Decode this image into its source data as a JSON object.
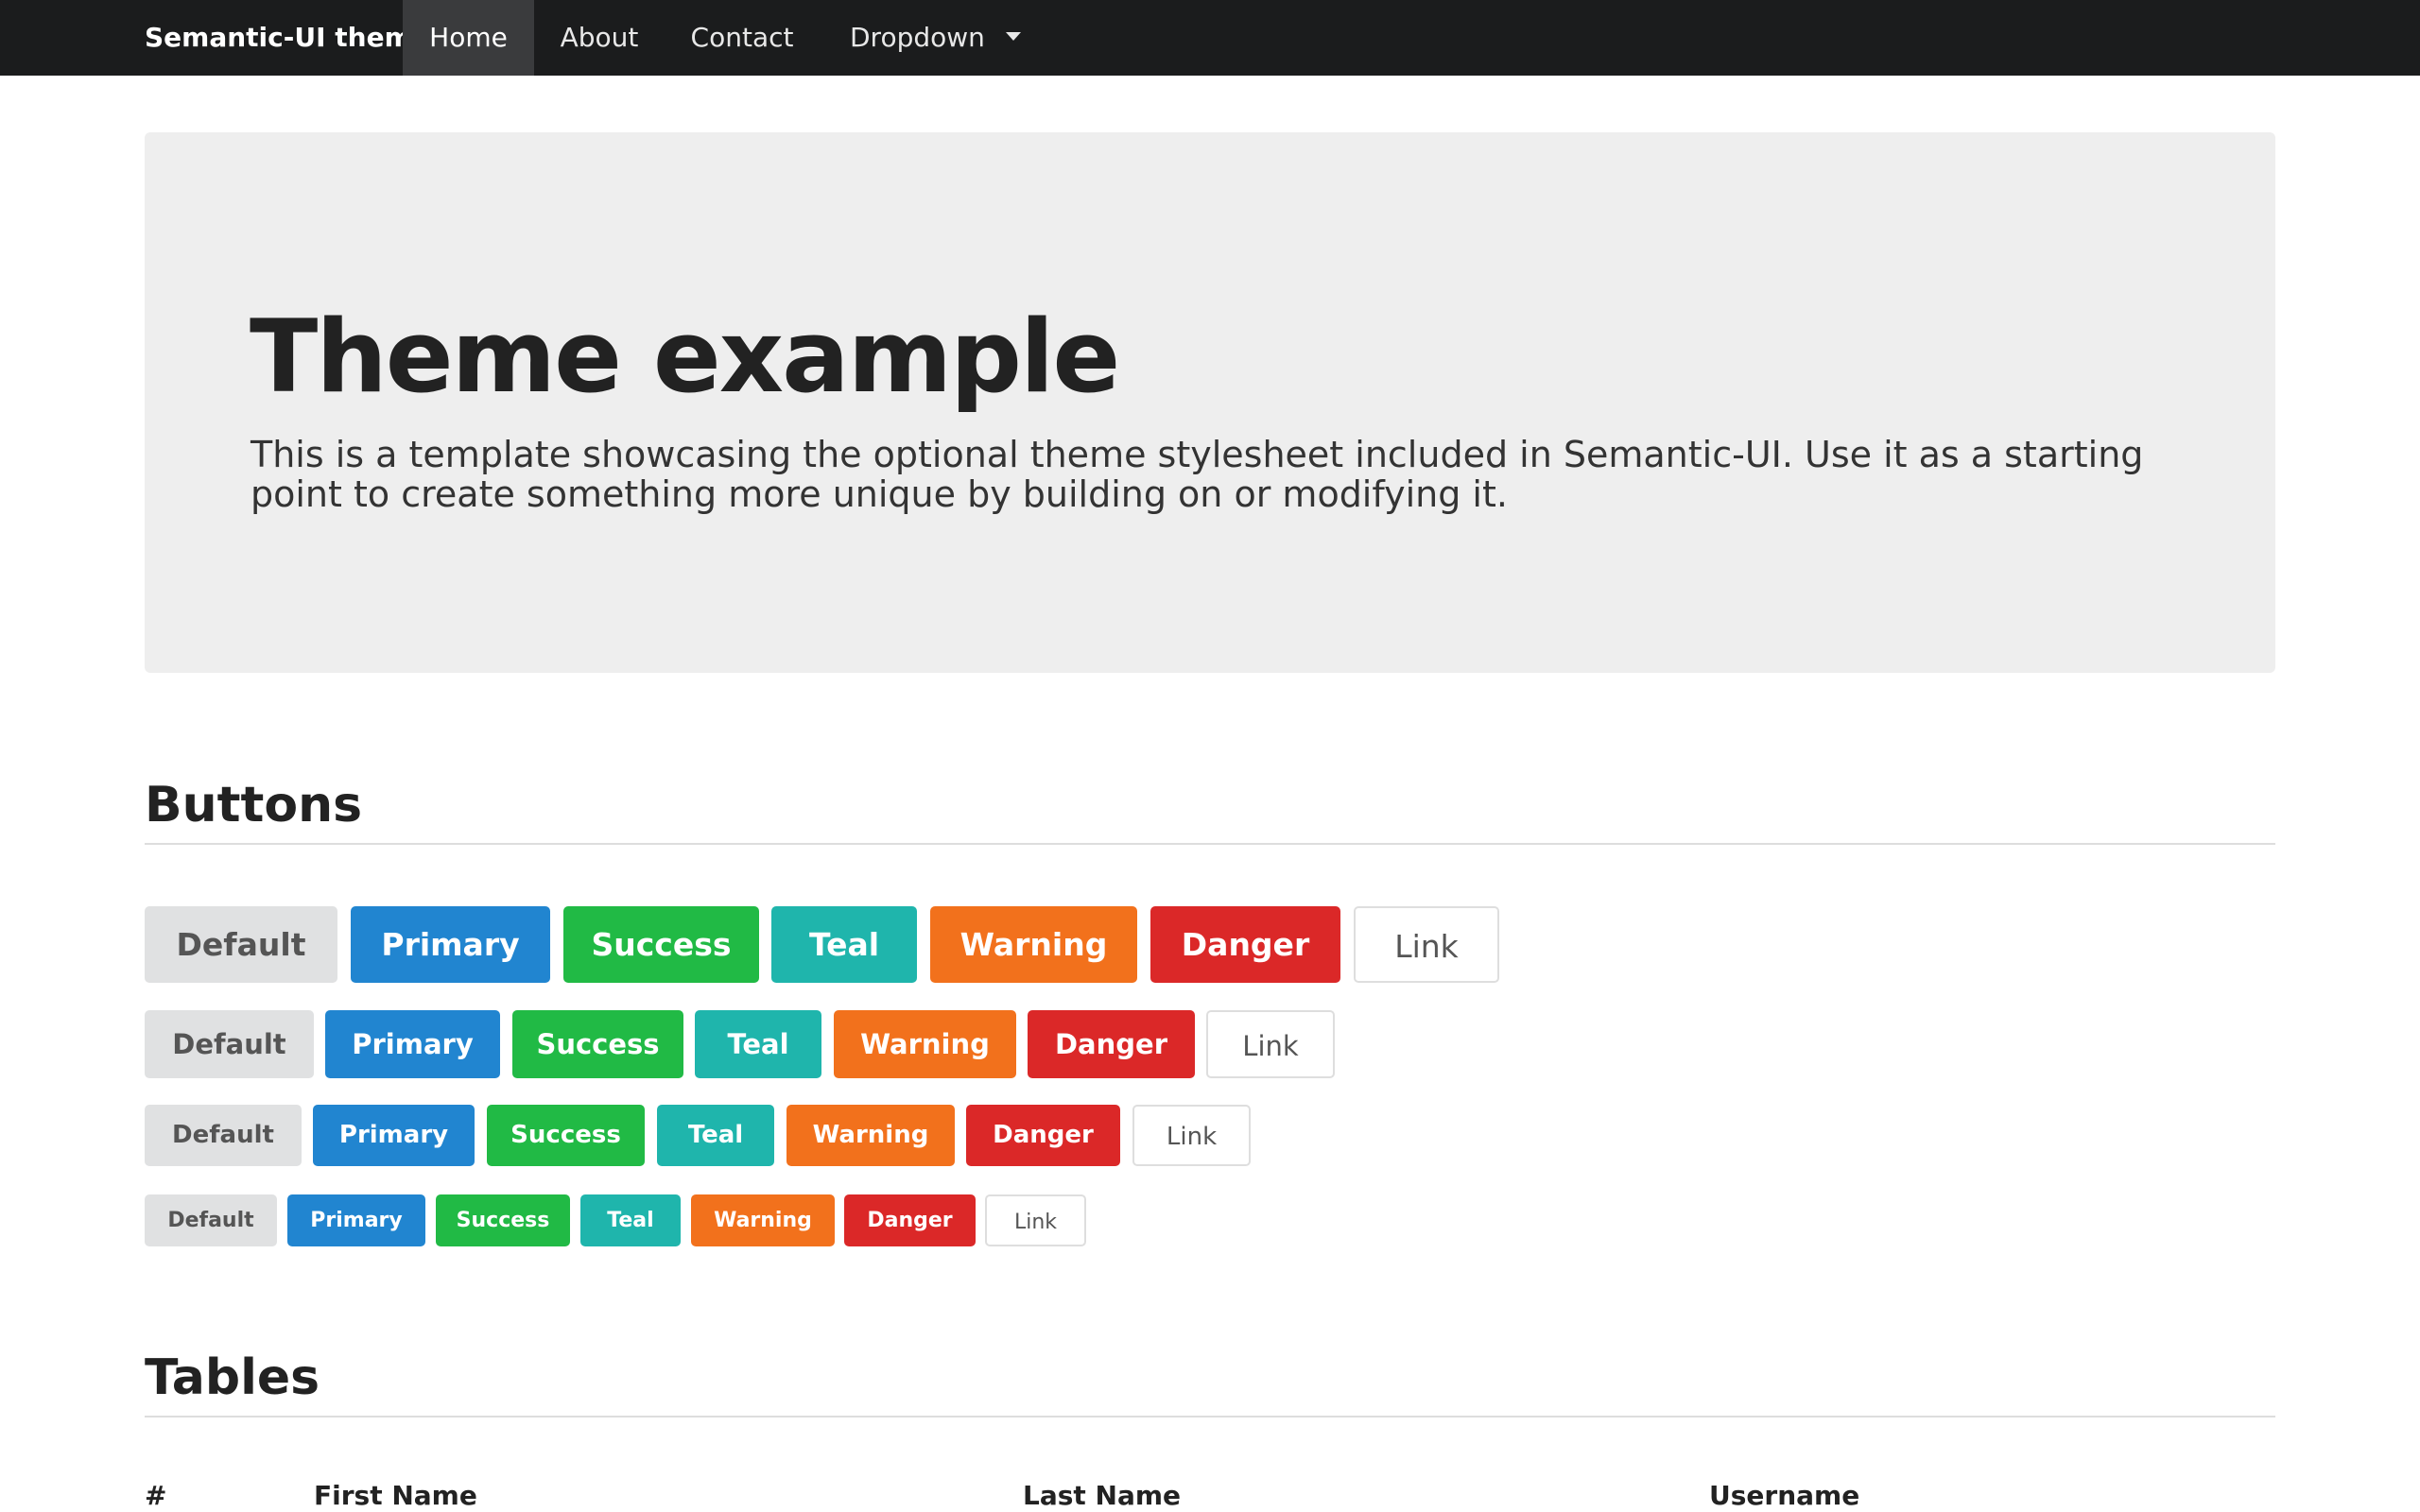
{
  "navbar": {
    "brand": "Semantic-UI theme",
    "items": [
      {
        "label": "Home",
        "active": true
      },
      {
        "label": "About",
        "active": false
      },
      {
        "label": "Contact",
        "active": false
      },
      {
        "label": "Dropdown",
        "active": false
      }
    ]
  },
  "jumbotron": {
    "title": "Theme example",
    "lead": "This is a template showcasing the optional theme stylesheet included in Semantic-UI. Use it as a starting point to create something more unique by building on or modifying it."
  },
  "buttons_section": {
    "title": "Buttons",
    "labels": {
      "default": "Default",
      "primary": "Primary",
      "success": "Success",
      "teal": "Teal",
      "warning": "Warning",
      "danger": "Danger",
      "link": "Link"
    },
    "sizes": [
      "large",
      "medium",
      "small",
      "mini"
    ]
  },
  "tables_section": {
    "title": "Tables",
    "columns": [
      "#",
      "First Name",
      "Last Name",
      "Username"
    ]
  },
  "colors": {
    "navbar_bg": "#1b1c1d",
    "default": "#e0e1e2",
    "primary": "#2185d0",
    "success": "#21ba45",
    "teal": "#1fb5ac",
    "warning": "#f2711c",
    "danger": "#db2828"
  }
}
